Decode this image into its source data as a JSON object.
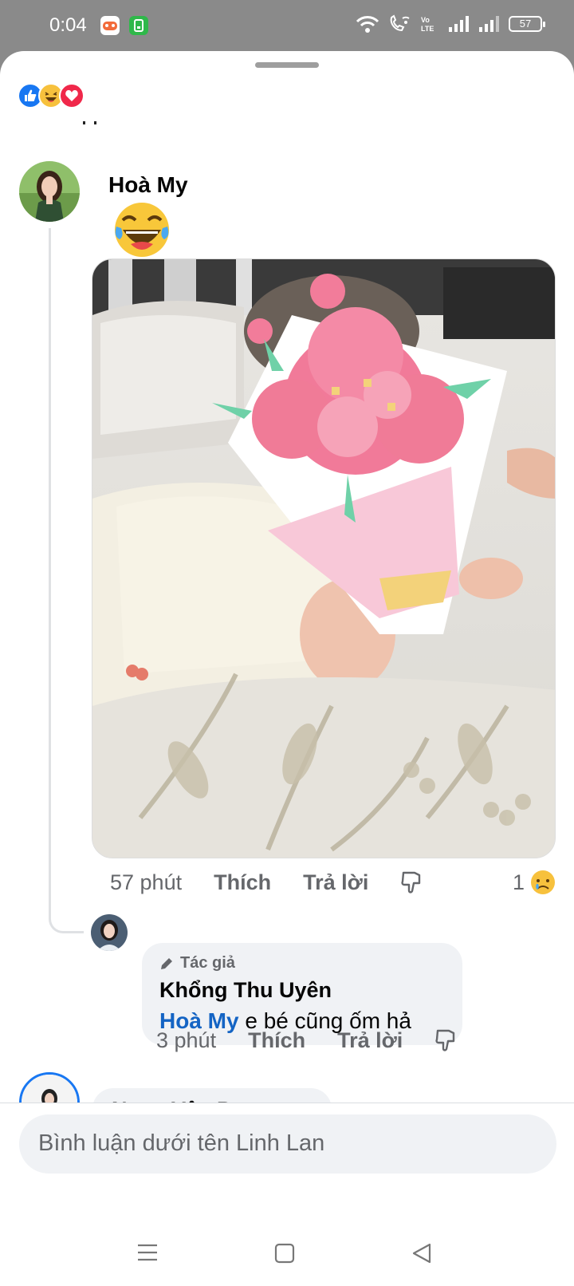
{
  "status_bar": {
    "time": "0:04",
    "battery": "57",
    "icons": [
      "game-app-icon",
      "green-app-icon",
      "wifi-icon",
      "wifi-call-icon",
      "volte-icon",
      "signal-icon",
      "signal-icon",
      "battery-icon"
    ]
  },
  "reactions_summary": [
    "like",
    "haha",
    "love"
  ],
  "comment": {
    "author": "Hoà My",
    "emoji": "laughing-tears-emoji",
    "time": "57 phút",
    "like_label": "Thích",
    "reply_label": "Trả lời",
    "reaction_count": "1",
    "reaction_type": "sad"
  },
  "reply": {
    "badge": "Tác giả",
    "author": "Khổng Thu Uyên",
    "mention": "Hoà My",
    "text": " e bé cũng ốm hả",
    "time": "3 phút",
    "like_label": "Thích",
    "reply_label": "Trả lời"
  },
  "next_comment": {
    "author": "Ngọc Vân Property"
  },
  "composer": {
    "placeholder": "Bình luận dưới tên Linh Lan"
  },
  "colors": {
    "accent": "#1877f2",
    "mention": "#1464c4",
    "bubble": "#f0f2f5",
    "muted": "#65676b"
  }
}
